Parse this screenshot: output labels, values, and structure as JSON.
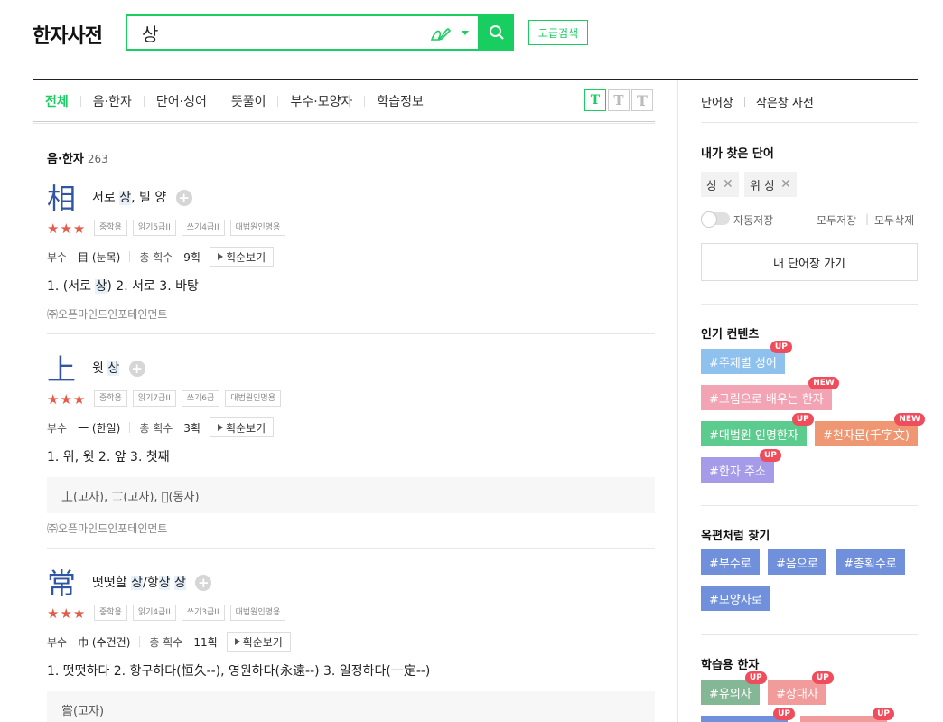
{
  "header": {
    "logo": "한자사전",
    "search_value": "상",
    "advanced_label": "고급검색"
  },
  "tabs": [
    {
      "label": "전체",
      "active": true
    },
    {
      "label": "음·한자"
    },
    {
      "label": "단어·성어"
    },
    {
      "label": "뜻풀이"
    },
    {
      "label": "부수·모양자"
    },
    {
      "label": "학습정보"
    }
  ],
  "text_size": [
    "T",
    "T",
    "T"
  ],
  "section": {
    "title": "음·한자",
    "count": "263"
  },
  "entries": [
    {
      "hanja": "相",
      "meaning_pre": "서로 ",
      "meaning_hl": "상",
      "meaning_post": ", 빌 양",
      "stars": "★★★",
      "badges": [
        "중학용",
        "읽기5급II",
        "쓰기4급II",
        "대법원인명용"
      ],
      "radical_label": "부수",
      "radical": "目 (눈목)",
      "strokes_label": "총 획수",
      "strokes": "9획",
      "stroke_btn": "획순보기",
      "defs_pre": "1. (서로 ",
      "defs_hl": "상",
      "defs_post": ")  2. 서로  3. 바탕",
      "credit": "㈜오픈마인드인포테인먼트"
    },
    {
      "hanja": "上",
      "meaning_pre": "윗 ",
      "meaning_hl": "상",
      "stars": "★★★",
      "badges": [
        "중학용",
        "읽기7급II",
        "쓰기6급",
        "대법원인명용"
      ],
      "radical_label": "부수",
      "radical": "一 (한일)",
      "strokes_label": "총 획수",
      "strokes": "3획",
      "stroke_btn": "획순보기",
      "defs": "1. 위, 윗  2. 앞  3. 첫째",
      "variants": "丄(고자), 𠄟(고자), 𠮧(동자)",
      "credit": "㈜오픈마인드인포테인먼트"
    },
    {
      "hanja": "常",
      "meaning_pre": "떳떳할 ",
      "meaning_hl": "상",
      "meaning_mid": "/항",
      "meaning_hl2": "상",
      "meaning_sp": " ",
      "meaning_hl3": "상",
      "stars": "★★★",
      "badges": [
        "중학용",
        "읽기4급II",
        "쓰기3급II",
        "대법원인명용"
      ],
      "radical_label": "부수",
      "radical": "巾 (수건건)",
      "strokes_label": "총 획수",
      "strokes": "11획",
      "stroke_btn": "획순보기",
      "defs": "1. 떳떳하다  2. 항구하다(恒久--), 영원하다(永遠--)  3. 일정하다(一定--)",
      "variants": "嘗(고자)"
    }
  ],
  "sidebar": {
    "tab1": "단어장",
    "tab2": "작은창 사전",
    "my_words_title": "내가 찾은 단어",
    "my_words": [
      "상",
      "위 상"
    ],
    "auto_save": "자동저장",
    "save_all": "모두저장",
    "delete_all": "모두삭제",
    "my_wordbook": "내 단어장 가기",
    "popular_title": "인기 컨텐츠",
    "popular": [
      {
        "label": "#주제별 성어",
        "flag": "UP",
        "color": "#8fc1ef"
      },
      {
        "label": "#그림으로 배우는 한자",
        "flag": "NEW",
        "color": "#f2a3b4"
      },
      {
        "label": "#대법원 인명한자",
        "flag": "UP",
        "color": "#5ccb8e"
      },
      {
        "label": "#천자문(千字文)",
        "flag": "NEW",
        "color": "#ef9772"
      },
      {
        "label": "#한자 주소",
        "flag": "UP",
        "color": "#a59be8"
      }
    ],
    "okpyeon_title": "옥편처럼 찾기",
    "okpyeon": [
      {
        "label": "#부수로",
        "color": "#7190db"
      },
      {
        "label": "#음으로",
        "color": "#7190db"
      },
      {
        "label": "#총획수로",
        "color": "#7190db"
      },
      {
        "label": "#모양자로",
        "color": "#7190db"
      }
    ],
    "study_title": "학습용 한자",
    "study": [
      {
        "label": "#유의자",
        "flag": "UP",
        "color": "#84b795"
      },
      {
        "label": "#상대자",
        "flag": "UP",
        "color": "#f29b9b"
      }
    ]
  }
}
